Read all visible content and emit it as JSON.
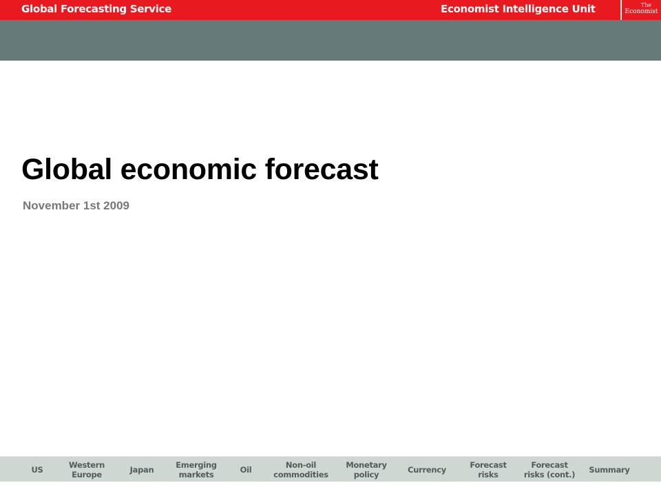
{
  "header": {
    "left_title": "Global Forecasting Service",
    "right_title": "Economist Intelligence Unit",
    "logo_line1": "The",
    "logo_line2": "Economist",
    "bar_color": "#e8191f",
    "band_color": "#677a7a"
  },
  "main": {
    "title": "Global economic forecast",
    "date": "November 1st 2009"
  },
  "bottom_nav": {
    "items": [
      {
        "label": "US"
      },
      {
        "label": "Western\nEurope"
      },
      {
        "label": "Japan"
      },
      {
        "label": "Emerging\nmarkets"
      },
      {
        "label": "Oil"
      },
      {
        "label": "Non-oil\ncommodities"
      },
      {
        "label": "Monetary\npolicy"
      },
      {
        "label": "Currency"
      },
      {
        "label": "Forecast\nrisks"
      },
      {
        "label": "Forecast\nrisks (cont.)"
      },
      {
        "label": "Summary"
      }
    ]
  }
}
